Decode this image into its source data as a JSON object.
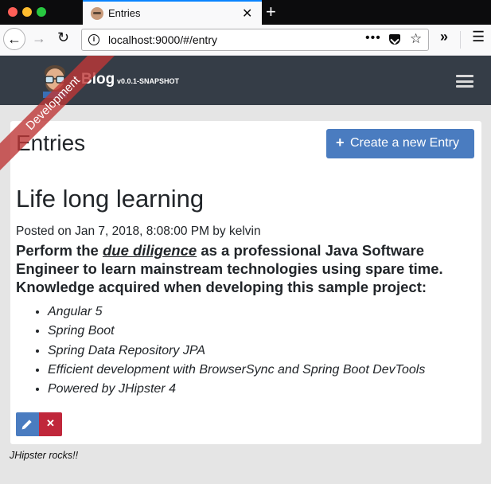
{
  "browser": {
    "tab_title": "Entries",
    "url": "localhost:9000/#/entry",
    "url_dots": "•••"
  },
  "app": {
    "brand": "Blog",
    "version": "v0.0.1-SNAPSHOT",
    "ribbon": "Development"
  },
  "page": {
    "title": "Entries",
    "create_button": "Create a new Entry"
  },
  "entry": {
    "title": "Life long learning",
    "posted": "Posted on Jan 7, 2018, 8:08:00 PM by kelvin",
    "body_before": "Perform the ",
    "body_emph": "due diligence",
    "body_after": " as a professional Java Software Engineer to learn mainstream technologies using spare time. Knowledge acquired when developing this sample project:",
    "items": [
      "Angular 5",
      "Spring Boot",
      "Spring Data Repository JPA",
      "Efficient development with BrowserSync and Spring Boot DevTools",
      "Powered by JHipster 4"
    ]
  },
  "footer": "JHipster rocks!!",
  "colors": {
    "navbar": "#353d47",
    "primary": "#4a7cc0",
    "danger": "#c0273b",
    "ribbon": "#be3737"
  }
}
